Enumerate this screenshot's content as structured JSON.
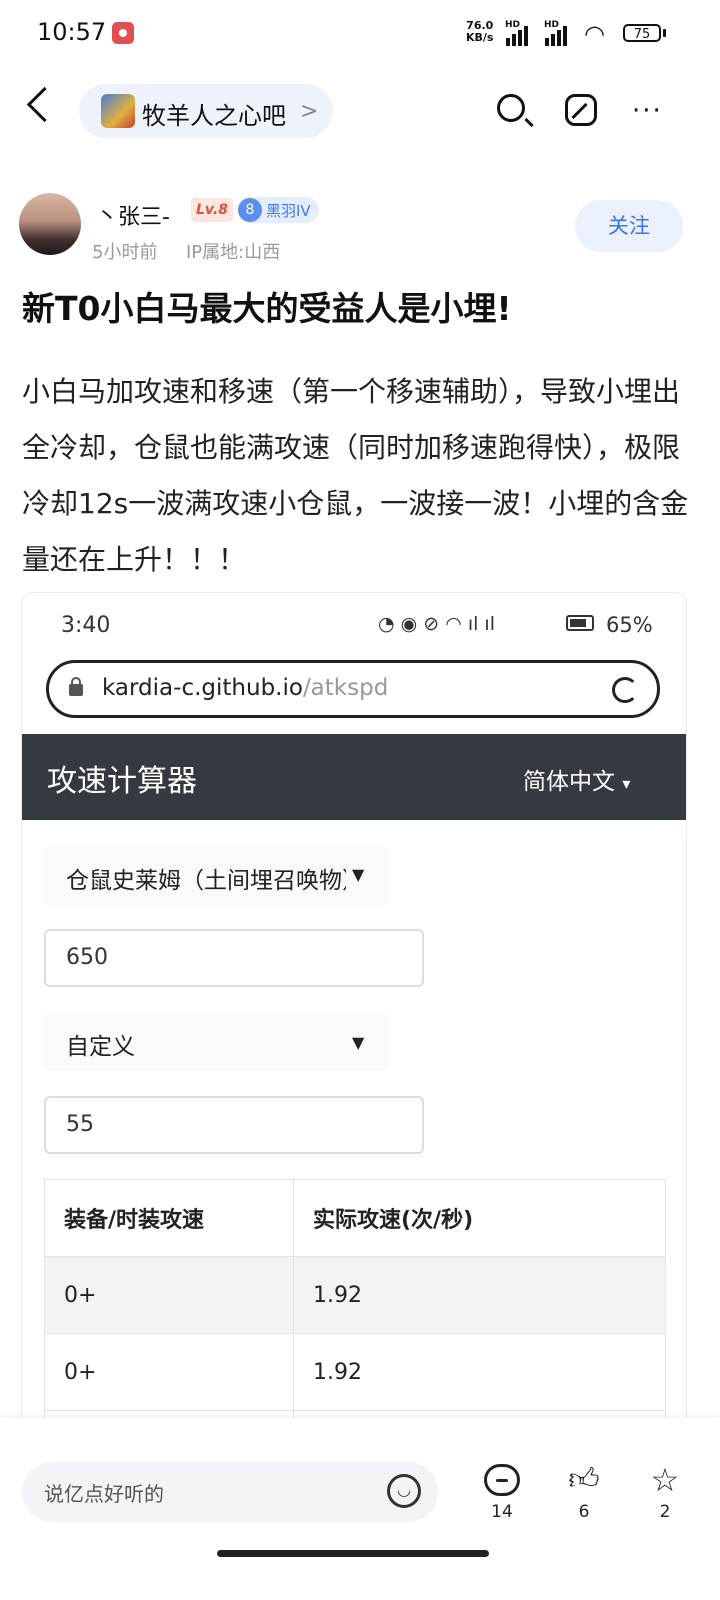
{
  "status_bar": {
    "time": "10:57",
    "net_speed_value": "76.0",
    "net_speed_unit": "KB/s",
    "battery": "75",
    "hd_label": "HD"
  },
  "nav": {
    "forum_name": "牧羊人之心吧"
  },
  "author": {
    "name": "丶张三-",
    "level": "Lv.8",
    "rank_num": "8",
    "rank_title": "黑羽IV",
    "time_ago": "5小时前",
    "ip_location": "IP属地:山西",
    "follow_label": "关注"
  },
  "post": {
    "title": "新T0小白马最大的受益人是小埋!",
    "body": "小白马加攻速和移速（第一个移速辅助），导致小埋出全冷却，仓鼠也能满攻速（同时加移速跑得快），极限冷却12s一波满攻速小仓鼠，一波接一波！小埋的含金量还在上升！！！"
  },
  "screenshot": {
    "status_time": "3:40",
    "battery_pct": "65%",
    "url_host": "kardia-c.github.io",
    "url_path": "/atkspd",
    "app_title": "攻速计算器",
    "lang": "简体中文",
    "character": "仓鼠史莱姆（土间埋召唤物）",
    "base_value": "650",
    "mode": "自定义",
    "custom_value": "55",
    "table": {
      "headers": [
        "装备/时装攻速",
        "实际攻速(次/秒)"
      ],
      "rows": [
        [
          "0+",
          "1.92"
        ],
        [
          "0+",
          "1.92"
        ]
      ]
    }
  },
  "bottom": {
    "comment_placeholder": "说亿点好听的",
    "reply_count": "14",
    "like_count": "6",
    "star_count": "2"
  }
}
